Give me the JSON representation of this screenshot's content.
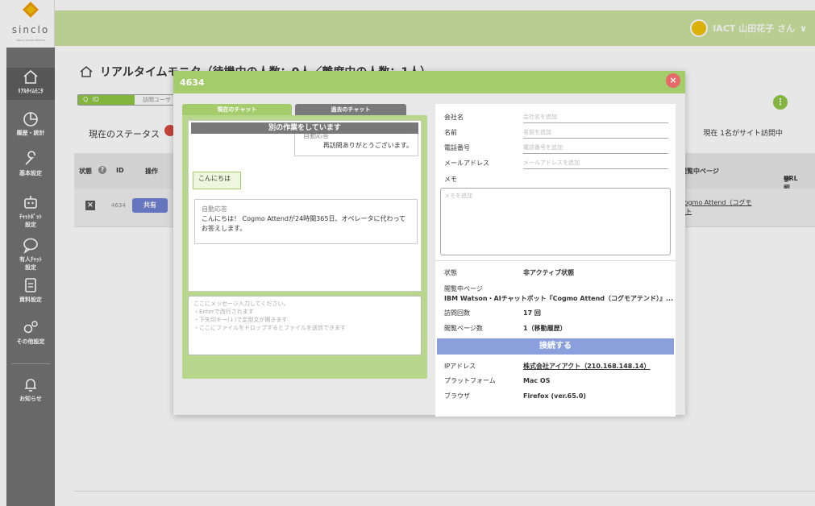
{
  "sidebar": {
    "brand": "sinclo",
    "brand_sub": "SINCLO CLOUD SERVICE",
    "items": [
      {
        "label": "ﾘｱﾙﾀｲﾑﾓﾆﾀ",
        "icon": "home-icon"
      },
      {
        "label": "履歴・統計",
        "icon": "pie-chart-icon"
      },
      {
        "label": "基本設定",
        "icon": "wrench-icon"
      },
      {
        "label": "ﾁｬｯﾄﾎﾞｯﾄ",
        "label2": "設定",
        "icon": "robot-icon"
      },
      {
        "label": "有人ﾁｬｯﾄ",
        "label2": "設定",
        "icon": "chat-bubble-icon"
      },
      {
        "label": "資料設定",
        "icon": "document-icon"
      },
      {
        "label": "その他設定",
        "icon": "gears-icon"
      },
      {
        "label": "お知らせ",
        "icon": "bell-icon"
      }
    ]
  },
  "topbar": {
    "user_name": "IACT 山田花子 さん"
  },
  "page": {
    "title": "リアルタイムモニタ（待機中の人数：0人／離席中の人数：1人）",
    "search_tab": "ID",
    "search_right": "訪問ユーザ",
    "status_label": "現在のステータス",
    "visitor_count": "現在 1名がサイト訪問中",
    "columns": {
      "state": "状態",
      "id": "ID",
      "op": "操作",
      "viewing": "閲覧中ページ",
      "ref1": "参照元",
      "ref2": "URL"
    },
    "row": {
      "id": "4634",
      "share": "共有",
      "viewing_line1": "ット『Cogmo Attend（コグモ",
      "viewing_line2": "アイアクト"
    }
  },
  "modal": {
    "id": "4634",
    "tabs": {
      "current": "現在のチャット",
      "past": "過去のチャット"
    },
    "busy_banner": "別の作業をしています",
    "messages": {
      "auto1_title": "自動応答",
      "auto1_text": "再訪問ありがとうございます。",
      "user1": "こんにちは",
      "auto2_title": "自動応答",
      "auto2_text": "こんにちは！ Cogmo Attendが24時間365日、オペレータに代わってお答えします。"
    },
    "input": {
      "placeholder1": "ここにメッセージ入力してください。",
      "placeholder2": "・Enterで改行されます",
      "placeholder3": "・下矢印キー(↓)で定型文が開きます",
      "placeholder4": "・ここにファイルをドロップするとファイルを送信できます"
    },
    "fields": [
      {
        "label": "会社名",
        "placeholder": "会社名を追加"
      },
      {
        "label": "名前",
        "placeholder": "名前を追加"
      },
      {
        "label": "電話番号",
        "placeholder": "電話番号を追加"
      },
      {
        "label": "メールアドレス",
        "placeholder": "メールアドレスを追加"
      }
    ],
    "memo_label": "メモ",
    "memo_placeholder": "メモを追加",
    "info": {
      "state_label": "状態",
      "state": "非アクティブ状態",
      "page_label": "閲覧中ページ",
      "page": "IBM Watson・AIチャットボット『Cogmo Attend（コグモアテンド）』...",
      "visits_label": "訪問回数",
      "visits": "17 回",
      "views_label": "閲覧ページ数",
      "views": "1（移動履歴）",
      "connect": "接続する",
      "ip_label": "IPアドレス",
      "ip": "株式会社アイアクト（210.168.148.14）",
      "platform_label": "プラットフォーム",
      "platform": "Mac OS",
      "browser_label": "ブラウザ",
      "browser": "Firefox (ver.65.0)"
    }
  },
  "colors": {
    "accent": "#8cc63f",
    "topbar": "#c9e39c",
    "sidebar": "#6f6f6f",
    "connect": "#8b9fdc",
    "close": "#e66a6a"
  }
}
